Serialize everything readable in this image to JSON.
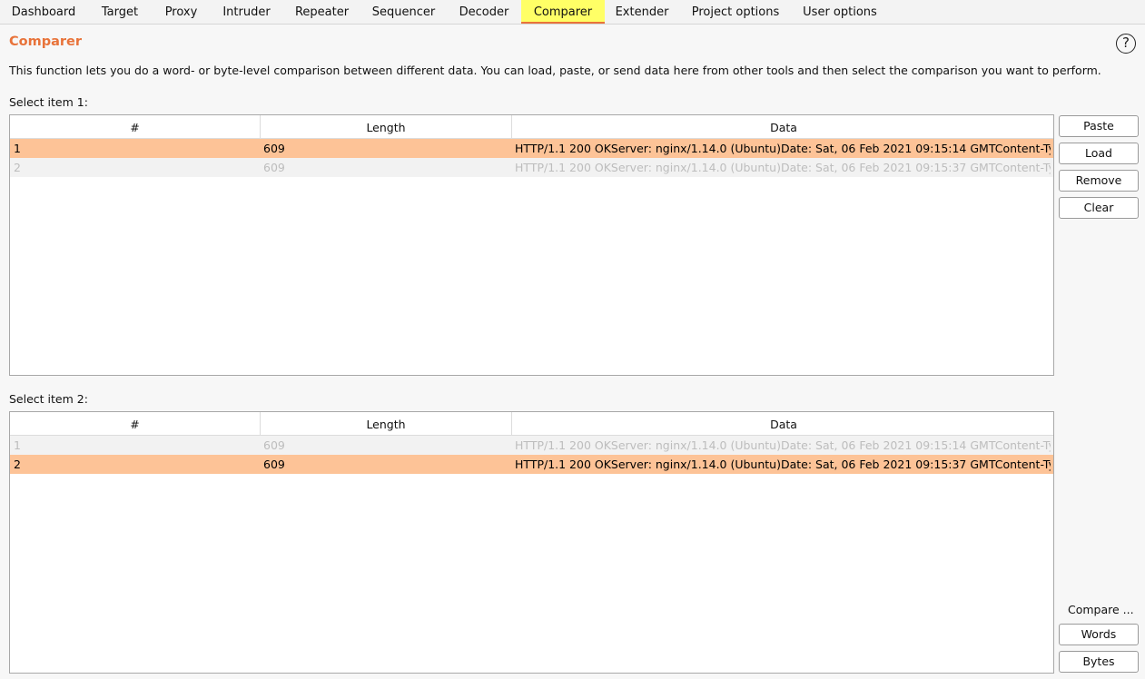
{
  "tabs": [
    {
      "label": "Dashboard",
      "active": false
    },
    {
      "label": "Target",
      "active": false
    },
    {
      "label": "Proxy",
      "active": false
    },
    {
      "label": "Intruder",
      "active": false
    },
    {
      "label": "Repeater",
      "active": false
    },
    {
      "label": "Sequencer",
      "active": false
    },
    {
      "label": "Decoder",
      "active": false
    },
    {
      "label": "Comparer",
      "active": true
    },
    {
      "label": "Extender",
      "active": false
    },
    {
      "label": "Project options",
      "active": false
    },
    {
      "label": "User options",
      "active": false
    }
  ],
  "header": {
    "title": "Comparer",
    "help_icon": "?",
    "description": "This function lets you do a word- or byte-level comparison between different data. You can load, paste, or send data here from other tools and then select the comparison you want to perform."
  },
  "columns": [
    "#",
    "Length",
    "Data"
  ],
  "item1": {
    "label": "Select item 1:",
    "rows": [
      {
        "num": "1",
        "length": "609",
        "data": "HTTP/1.1 200 OKServer: nginx/1.14.0 (Ubuntu)Date: Sat, 06 Feb 2021 09:15:14 GMTContent-Type:...",
        "selected": true
      },
      {
        "num": "2",
        "length": "609",
        "data": "HTTP/1.1 200 OKServer: nginx/1.14.0 (Ubuntu)Date: Sat, 06 Feb 2021 09:15:37 GMTContent-Type:...",
        "selected": false
      }
    ]
  },
  "item2": {
    "label": "Select item 2:",
    "rows": [
      {
        "num": "1",
        "length": "609",
        "data": "HTTP/1.1 200 OKServer: nginx/1.14.0 (Ubuntu)Date: Sat, 06 Feb 2021 09:15:14 GMTContent-Type:...",
        "selected": false
      },
      {
        "num": "2",
        "length": "609",
        "data": "HTTP/1.1 200 OKServer: nginx/1.14.0 (Ubuntu)Date: Sat, 06 Feb 2021 09:15:37 GMTContent-Type:...",
        "selected": true
      }
    ]
  },
  "buttons": {
    "paste": "Paste",
    "load": "Load",
    "remove": "Remove",
    "clear": "Clear",
    "compare_label": "Compare ...",
    "words": "Words",
    "bytes": "Bytes"
  },
  "colors": {
    "accent": "#e8733a",
    "active_tab": "#ffff66",
    "selected_row": "#fdc397"
  }
}
